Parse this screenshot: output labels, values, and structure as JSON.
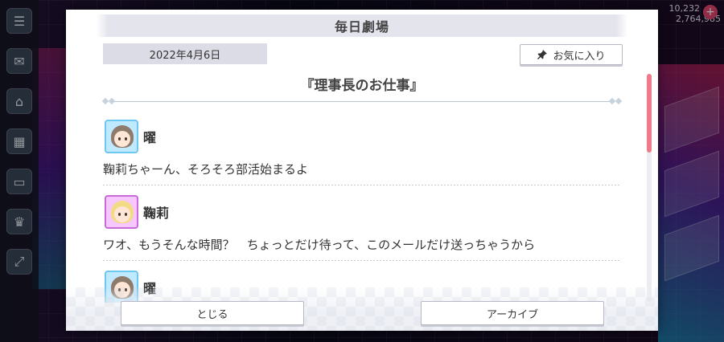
{
  "background": {
    "counter_top": "10,232",
    "counter_bottom": "2,764,985",
    "plus_label": "+",
    "left_rail_icons": [
      "menu-icon",
      "chat-icon",
      "gift-box-icon",
      "present-icon",
      "screen-icon",
      "trophy-icon",
      "fullscreen-icon"
    ]
  },
  "dialog": {
    "title": "毎日劇場",
    "date": "2022年4月6日",
    "favorite_button_label": "お気に入り",
    "episode_title": "『理事長のお仕事』",
    "entries": [
      {
        "speaker": "曜",
        "line": "鞠莉ちゃーん、そろそろ部活始まるよ"
      },
      {
        "speaker": "鞠莉",
        "line": "ワオ、もうそんな時間？　ちょっとだけ待って、このメールだけ送っちゃうから"
      },
      {
        "speaker": "曜",
        "line": ""
      }
    ],
    "close_button_label": "とじる",
    "archive_button_label": "アーカイブ"
  },
  "colors": {
    "accent_scroll": "#f07a8c",
    "you_avatar_border": "#6ec7f0",
    "mari_avatar_border": "#c86bd9"
  }
}
